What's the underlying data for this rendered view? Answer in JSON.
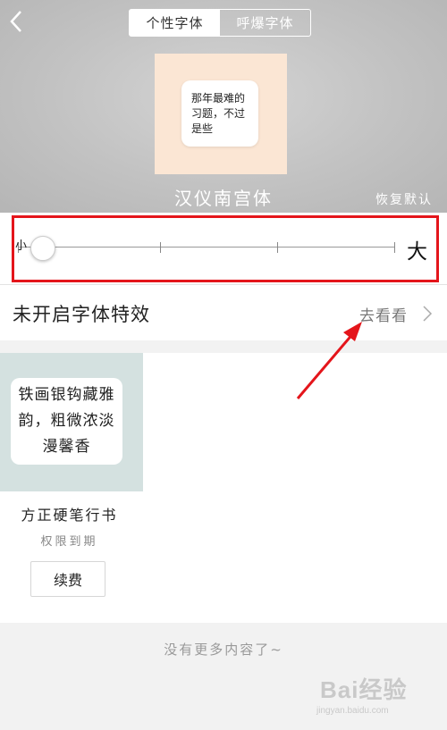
{
  "header": {
    "tabs": [
      {
        "label": "个性字体",
        "active": true
      },
      {
        "label": "呼爆字体",
        "active": false
      }
    ],
    "preview_text": "那年最难的习题，不过是些",
    "font_name": "汉仪南宫体",
    "restore_label": "恢复默认"
  },
  "size_slider": {
    "small_label": "小",
    "large_label": "大",
    "level": 0,
    "steps": 4
  },
  "effect": {
    "label": "未开启字体特效",
    "action_label": "去看看"
  },
  "font_card": {
    "sample_text": "铁画银钩藏雅韵，粗微浓淡漫馨香",
    "title": "方正硬笔行书",
    "subtitle": "权限到期",
    "button_label": "续费"
  },
  "footer_text": "没有更多内容了~",
  "watermark": {
    "brand": "Bai经验",
    "url": "jingyan.baidu.com"
  },
  "colors": {
    "highlight": "#e4151b",
    "header_bg": "#c2c2c2",
    "preview_bg": "#fbe6d4",
    "card_bg": "#d4e1e0"
  }
}
